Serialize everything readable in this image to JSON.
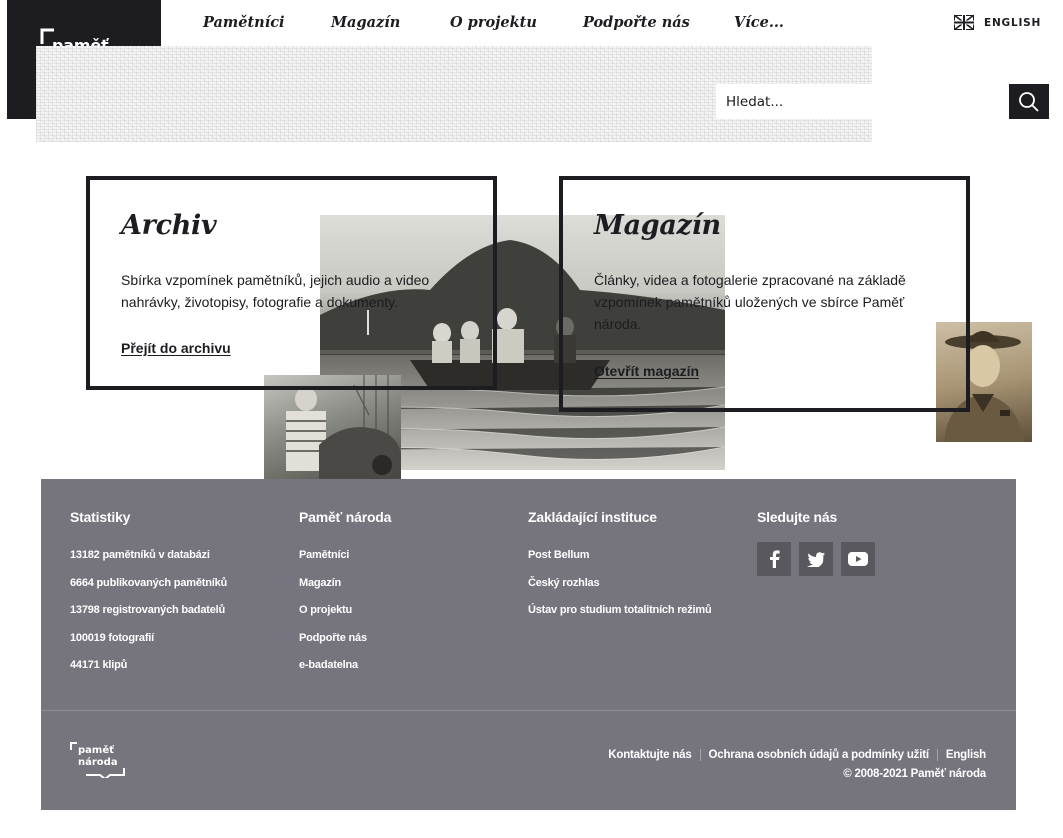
{
  "brand": {
    "logo_line1": "paměť",
    "logo_line2": "národa"
  },
  "nav": [
    {
      "label": "Pamětníci"
    },
    {
      "label": "Magazín"
    },
    {
      "label": "O projektu"
    },
    {
      "label": "Podpořte nás"
    },
    {
      "label": "Více..."
    }
  ],
  "language": {
    "label": "ENGLISH",
    "icon": "uk-flag-icon"
  },
  "search": {
    "placeholder": "Hledat...",
    "icon": "search-icon"
  },
  "cards": {
    "archiv": {
      "title": "Archiv",
      "text": "Sbírka vzpomínek pamětníků, jejich audio a video nahrávky, životopisy, fotografie a dokumenty.",
      "link": "Přejít do archivu"
    },
    "magazin": {
      "title": "Magazín",
      "text": "Články, videa a fotogalerie zpracované na základě vzpomínek pamětníků uložených ve sbírce Paměť národa.",
      "link": "Otevřít magazín"
    }
  },
  "footer": {
    "stats": {
      "title": "Statistiky",
      "items": [
        "13182 pamětníků v databázi",
        "6664 publikovaných pamětníků",
        "13798 registrovaných badatelů",
        "100019 fotografií",
        "44171 klipů"
      ]
    },
    "pamet": {
      "title": "Paměť národa",
      "items": [
        "Pamětníci",
        "Magazín",
        "O projektu",
        "Podpořte nás",
        "e-badatelna"
      ]
    },
    "institutions": {
      "title": "Zakládající instituce",
      "items": [
        "Post Bellum",
        "Český rozhlas",
        "Ústav pro studium totalitních režimů"
      ]
    },
    "social": {
      "title": "Sledujte nás",
      "icons": [
        "facebook-icon",
        "twitter-icon",
        "youtube-icon"
      ]
    },
    "bottom_links": [
      "Kontaktujte nás",
      "Ochrana osobních údajů a podmínky užití",
      "English"
    ],
    "copyright": "© 2008-2021 Paměť národa"
  },
  "colors": {
    "dark": "#1d1c20",
    "footer_bg": "#76757e",
    "social_bg": "#59585f"
  }
}
